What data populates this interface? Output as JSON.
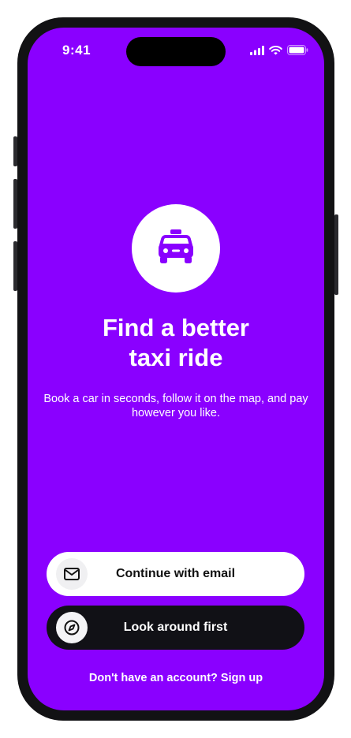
{
  "status_bar": {
    "time": "9:41",
    "icons": [
      "signal-icon",
      "wifi-icon",
      "battery-icon"
    ]
  },
  "hero": {
    "icon": "taxi-icon",
    "title": "Find a better\ntaxi ride",
    "subtitle": "Book a car in seconds, follow it on the map, and pay however you like."
  },
  "actions": {
    "email": {
      "label": "Continue with email",
      "icon": "mail-icon"
    },
    "look_around": {
      "label": "Look around first",
      "icon": "compass-icon"
    }
  },
  "footer": {
    "prompt": "Don't have an account?",
    "link": "Sign up"
  },
  "colors": {
    "background": "#8a00ff",
    "primary_button": "#ffffff",
    "secondary_button": "#111116",
    "accent_icon": "#8a00ff"
  }
}
